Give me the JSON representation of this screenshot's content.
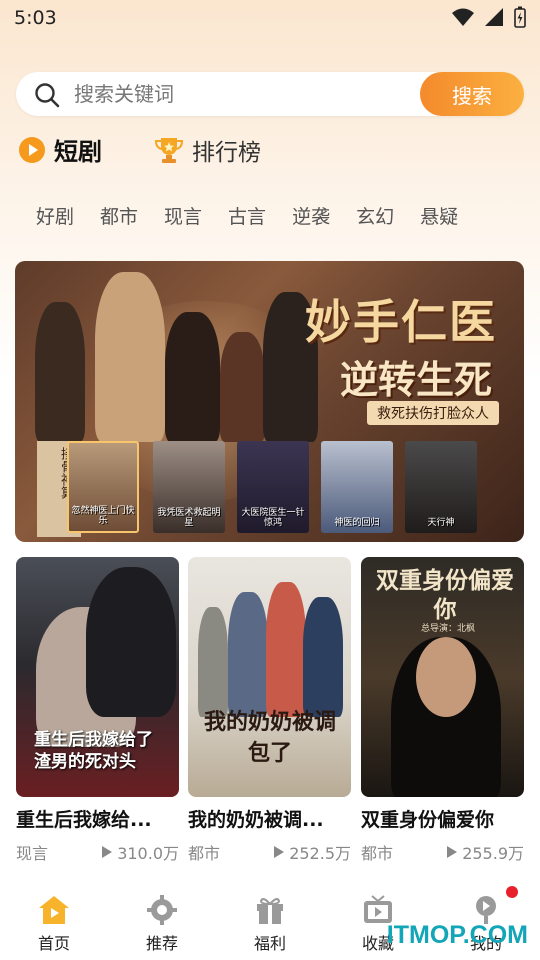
{
  "status": {
    "time": "5:03"
  },
  "search": {
    "placeholder": "搜索关键词",
    "button": "搜索"
  },
  "top_tabs": [
    {
      "label": "短剧",
      "icon": "play-circle-icon",
      "active": true
    },
    {
      "label": "排行榜",
      "icon": "trophy-icon",
      "active": false
    }
  ],
  "categories": [
    "好剧",
    "都市",
    "现言",
    "古言",
    "逆袭",
    "玄幻",
    "悬疑"
  ],
  "banner": {
    "title_line1": "妙手仁医",
    "title_line2": "逆转生死",
    "tagline": "救死扶伤打脸众人",
    "side_text": "接骨神算",
    "thumbs": [
      "忽然神医上门快乐",
      "我凭医术救起明星",
      "大医院医生一针惊鸿",
      "神医的回归",
      "天行神"
    ]
  },
  "cards": [
    {
      "title": "重生后我嫁给...",
      "genre": "现言",
      "plays": "310.0万",
      "poster_text": "重生后我嫁给了渣男的死对头"
    },
    {
      "title": "我的奶奶被调...",
      "genre": "都市",
      "plays": "252.5万",
      "poster_text": "我的奶奶被调包了"
    },
    {
      "title": "双重身份偏爱你",
      "genre": "都市",
      "plays": "255.9万",
      "poster_text": "双重身份偏爱你",
      "poster_sub": "总导演：北枫"
    }
  ],
  "nav": [
    {
      "label": "首页",
      "icon": "home-icon",
      "active": true
    },
    {
      "label": "推荐",
      "icon": "gear-icon",
      "active": false
    },
    {
      "label": "福利",
      "icon": "gift-icon",
      "active": false
    },
    {
      "label": "收藏",
      "icon": "tv-icon",
      "active": false
    },
    {
      "label": "我的",
      "icon": "profile-icon",
      "active": false
    }
  ],
  "watermark": "ITMOP.COM",
  "colors": {
    "accent": "#f48a2c",
    "accent_light": "#fbb040",
    "badge": "#e8202c"
  }
}
